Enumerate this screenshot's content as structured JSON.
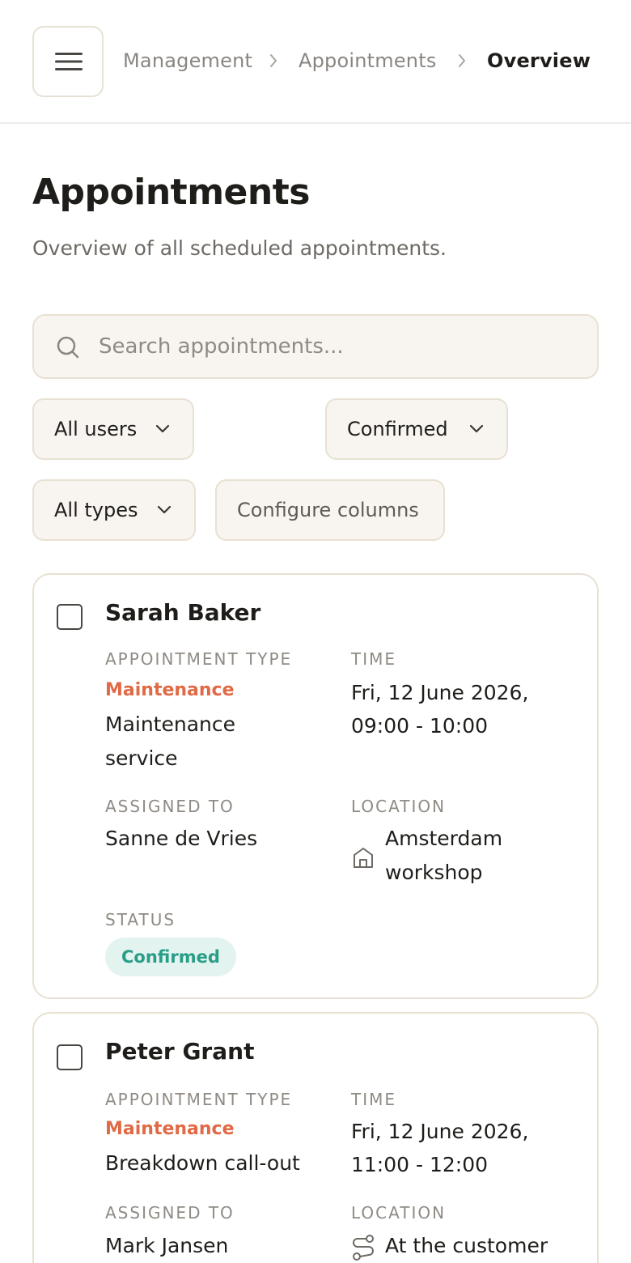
{
  "breadcrumb": {
    "items": [
      "Management",
      "Appointments"
    ],
    "current": "Overview"
  },
  "header": {
    "title": "Appointments",
    "subtitle": "Overview of all scheduled appointments."
  },
  "search": {
    "placeholder": "Search appointments...",
    "value": ""
  },
  "filters": {
    "users": "All users",
    "status": "Confirmed",
    "types": "All types",
    "configure": "Configure columns"
  },
  "labels": {
    "type": "APPOINTMENT TYPE",
    "time": "TIME",
    "assigned": "ASSIGNED TO",
    "location": "LOCATION",
    "status": "STATUS"
  },
  "appointments": [
    {
      "name": "Sarah Baker",
      "category": "Maintenance",
      "type_line1": "Maintenance",
      "type_line2": "service",
      "time_line1": "Fri, 12 June 2026,",
      "time_line2": "09:00 - 10:00",
      "assigned": "Sanne de Vries",
      "location_line1": "Amsterdam",
      "location_line2": "workshop",
      "location_icon": "building-icon",
      "status": "Confirmed"
    },
    {
      "name": "Peter Grant",
      "category": "Maintenance",
      "type_line1": "Breakdown call-out",
      "time_line1": "Fri, 12 June 2026,",
      "time_line2": "11:00 - 12:00",
      "assigned": "Mark Jansen",
      "location_line1": "At the customer",
      "location_icon": "route-icon"
    }
  ],
  "colors": {
    "accent_category": "#e06a45",
    "status_confirmed_bg": "#e3f3f0",
    "status_confirmed_text": "#2a9d87",
    "field_bg": "#f8f5f0",
    "border": "#e8e1d3"
  }
}
